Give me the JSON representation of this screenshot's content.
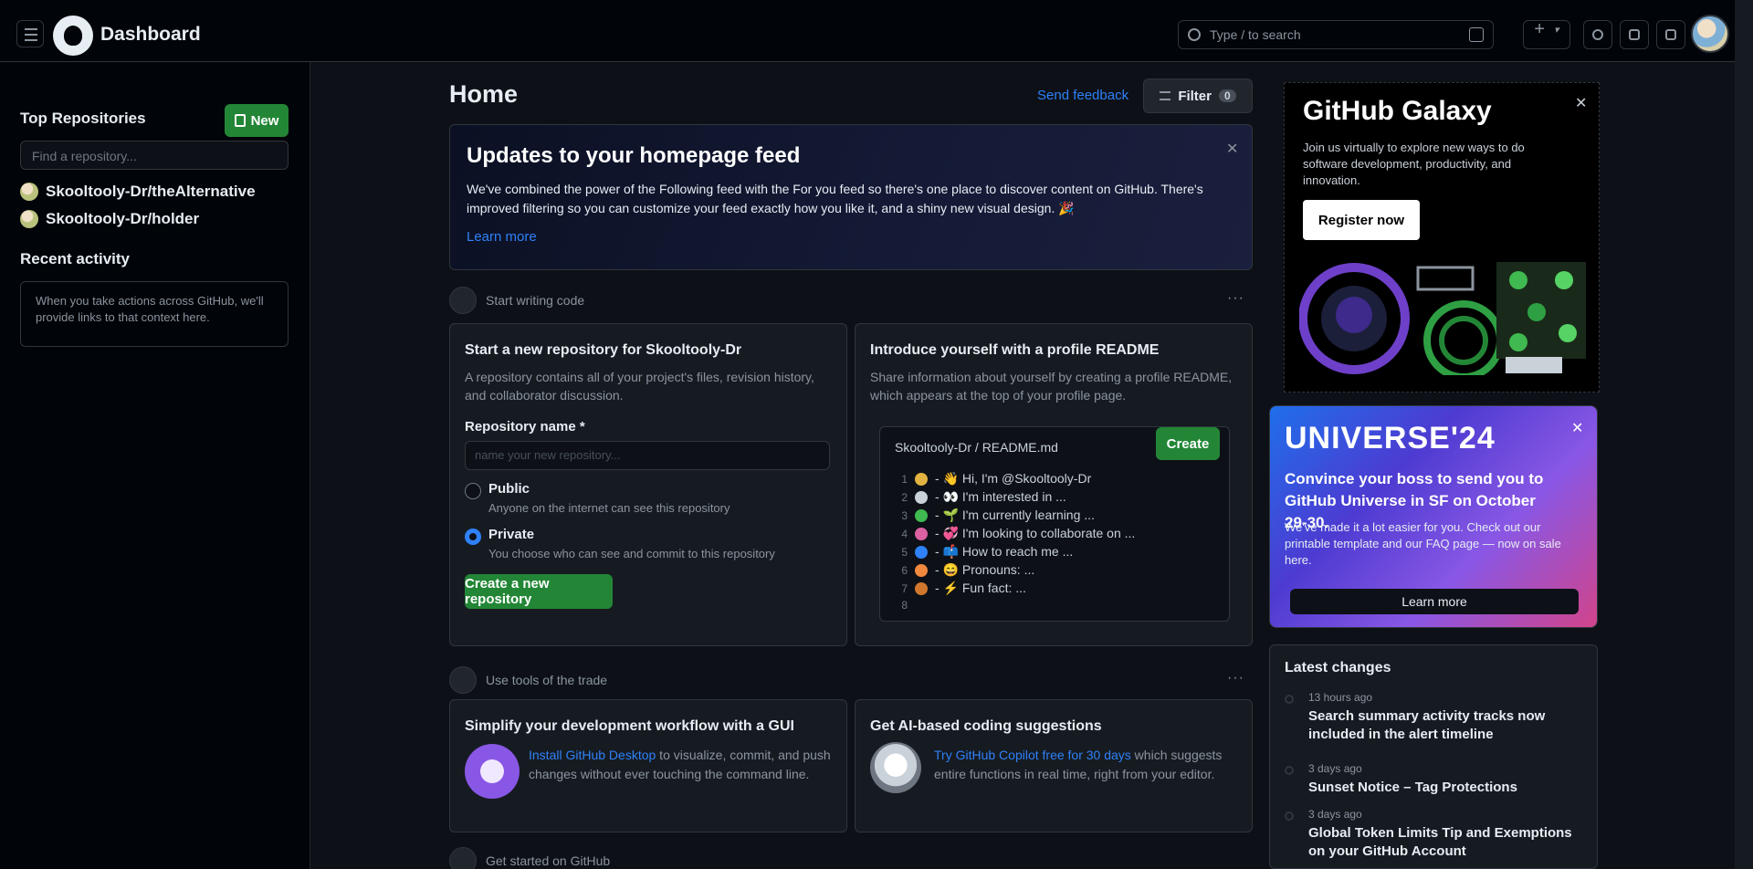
{
  "header": {
    "title": "Dashboard",
    "search_placeholder": "Type / to search"
  },
  "sidebar": {
    "top_repositories_title": "Top Repositories",
    "new_button_label": "New",
    "find_repo_placeholder": "Find a repository...",
    "repos": [
      "Skooltooly-Dr/theAlternative",
      "Skooltooly-Dr/holder"
    ],
    "recent_activity_title": "Recent activity",
    "recent_activity_text": "When you take actions across GitHub, we'll provide links to that context here."
  },
  "main": {
    "title": "Home",
    "send_feedback": "Send feedback",
    "filter_label": "Filter",
    "filter_count": "0",
    "update": {
      "title": "Updates to your homepage feed",
      "body": "We've combined the power of the Following feed with the For you feed so there's one place to discover content on GitHub. There's improved filtering so you can customize your feed exactly how you like it, and a shiny new visual design. 🎉",
      "learn_more": "Learn more"
    },
    "start_section_label": "Start writing code",
    "start_section_menu": "···",
    "new_repo_card": {
      "title": "Start a new repository for Skooltooly-Dr",
      "desc": "A repository contains all of your project's files, revision history, and collaborator discussion.",
      "name_label": "Repository name *",
      "name_placeholder": "name your new repository...",
      "public_label": "Public",
      "public_desc": "Anyone on the internet can see this repository",
      "private_label": "Private",
      "private_desc": "You choose who can see and commit to this repository",
      "create_button": "Create a new repository"
    },
    "readme_card": {
      "title": "Introduce yourself with a profile README",
      "desc": "Share information about yourself by creating a profile README, which appears at the top of your profile page.",
      "path": "Skooltooly-Dr / README.md",
      "create_button": "Create",
      "lines": [
        {
          "n": "1",
          "text": "- 👋 Hi, I'm @Skooltooly-Dr",
          "color": "#e3b341"
        },
        {
          "n": "2",
          "text": "- 👀 I'm interested in ...",
          "color": "#c9d1d9"
        },
        {
          "n": "3",
          "text": "- 🌱 I'm currently learning ...",
          "color": "#3fb950"
        },
        {
          "n": "4",
          "text": "- 💞️ I'm looking to collaborate on ...",
          "color": "#db61a2"
        },
        {
          "n": "5",
          "text": "- 📫 How to reach me ...",
          "color": "#2f81f7"
        },
        {
          "n": "6",
          "text": "- 😄 Pronouns: ...",
          "color": "#f0883e"
        },
        {
          "n": "7",
          "text": "- ⚡ Fun fact: ...",
          "color": "#d1772d"
        },
        {
          "n": "8",
          "text": "",
          "color": ""
        }
      ]
    },
    "tools_section_label": "Use tools of the trade",
    "tools_section_menu": "···",
    "desktop_card": {
      "title": "Simplify your development workflow with a GUI",
      "link": "Install GitHub Desktop",
      "text": " to visualize, commit, and push changes without ever touching the command line."
    },
    "copilot_card": {
      "title": "Get AI-based coding suggestions",
      "link": "Try GitHub Copilot free for 30 days",
      "text": " which suggests entire functions in real time, right from your editor."
    },
    "explore_section_label": "Get started on GitHub"
  },
  "right": {
    "galaxy_title": "GitHub Galaxy",
    "galaxy_desc": "Join us virtually to explore new ways to do software development, productivity, and innovation.",
    "galaxy_button": "Register now",
    "universe_logo": "UNIVERSE'24",
    "universe_headline": "Convince your boss to send you to GitHub Universe in SF on October 29-30.",
    "universe_desc": "We've made it a lot easier for you. Check out our printable template and our FAQ page — now on sale here.",
    "universe_button": "Learn more",
    "latest_changes_title": "Latest changes",
    "changes": [
      {
        "when": "13 hours ago",
        "what": "Search summary activity tracks now included in the alert timeline"
      },
      {
        "when": "3 days ago",
        "what": "Sunset Notice – Tag Protections"
      },
      {
        "when": "3 days ago",
        "what": "Global Token Limits Tip and Exemptions on your GitHub Account"
      }
    ]
  }
}
